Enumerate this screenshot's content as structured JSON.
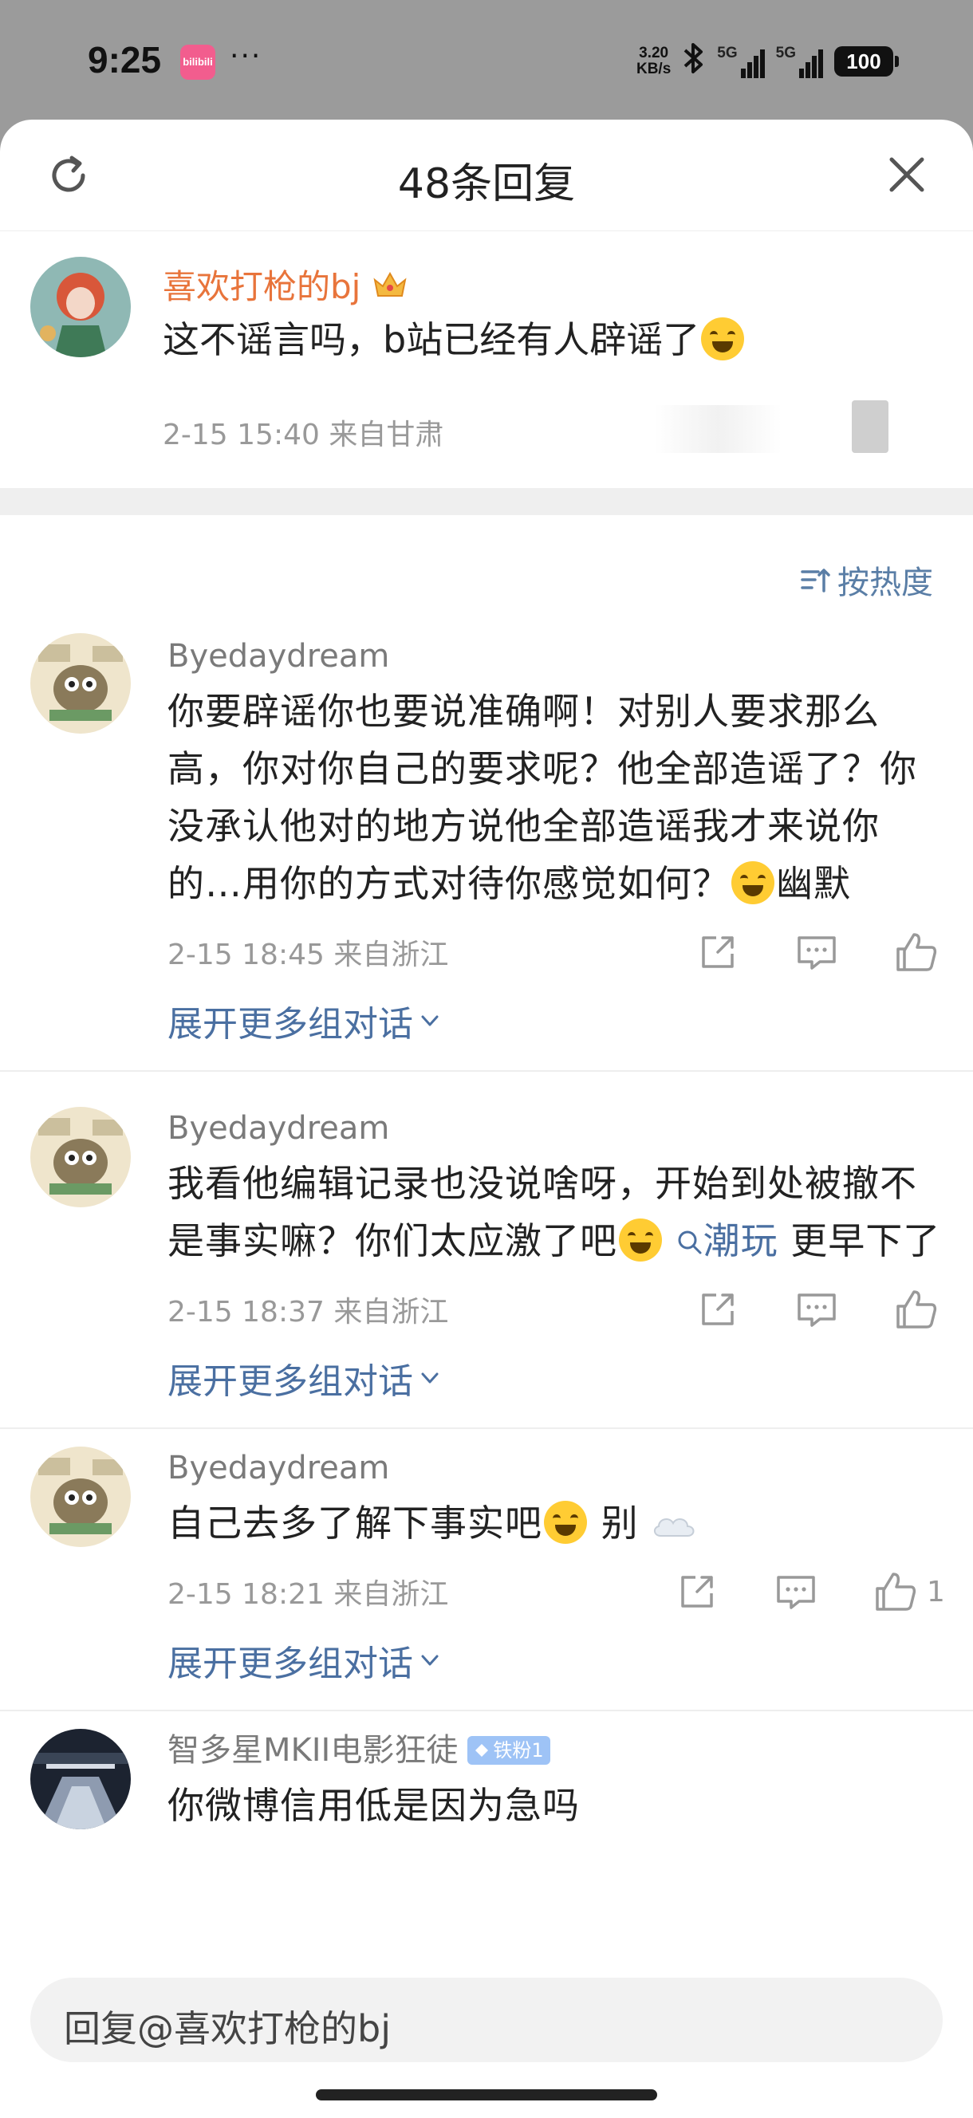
{
  "status_bar": {
    "time": "9:25",
    "app_icon_text": "bilibili",
    "more": "···",
    "speed_value": "3.20",
    "speed_unit": "KB/s",
    "net1": "5G",
    "net2": "5G",
    "battery": "100"
  },
  "header": {
    "title": "48条回复"
  },
  "original": {
    "username": "喜欢打枪的bj",
    "text": "这不谣言吗，b站已经有人辟谣了",
    "meta": "2-15 15:40  来自甘肃"
  },
  "sort": {
    "label": "按热度"
  },
  "replies": [
    {
      "username": "Byedaydream",
      "text_a": "你要辟谣你也要说准确啊！对别人要求那么高，你对你自己的要求呢？他全部造谣了？你没承认他对的地方说他全部造谣我才来说你的…用你的方式对待你感觉如何？",
      "text_b": "幽默",
      "meta": "2-15 18:45  来自浙江",
      "like_count": "",
      "expand": "展开更多组对话"
    },
    {
      "username": "Byedaydream",
      "text_a": "我看他编辑记录也没说啥呀，开始到处被撤不是事实嘛？你们太应激了吧",
      "topic": "潮玩",
      "text_b": " 更早下了",
      "meta": "2-15 18:37  来自浙江",
      "like_count": "",
      "expand": "展开更多组对话"
    },
    {
      "username": "Byedaydream",
      "text_a": "自己去多了解下事实吧",
      "text_b": " 别",
      "meta": "2-15 18:21  来自浙江",
      "like_count": "1",
      "expand": "展开更多组对话"
    },
    {
      "username": "智多星MKII电影狂徒",
      "badge": "铁粉1",
      "text_a": "你微博信用低是因为急吗"
    }
  ],
  "input": {
    "placeholder": "回复@喜欢打枪的bj"
  },
  "colors": {
    "accent": "#4a6fa1",
    "orig_username": "#e8743b",
    "meta": "#999999",
    "background_dim": "#9b9b9b"
  }
}
